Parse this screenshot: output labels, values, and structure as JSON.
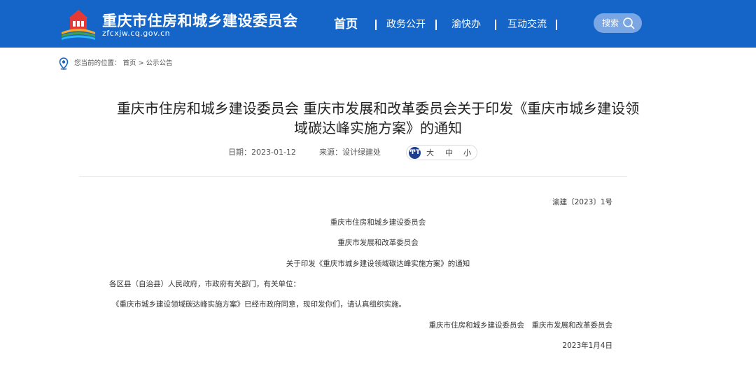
{
  "header": {
    "title": "重庆市住房和城乡建设委员会",
    "domain": "zfcxjw.cq.gov.cn",
    "nav": [
      "首页",
      "政务公开",
      "渝快办",
      "互动交流"
    ],
    "search_label": "搜索"
  },
  "breadcrumb": {
    "prefix": "您当前的位置：",
    "path": "首页 > 公示公告"
  },
  "article": {
    "title_line1": "重庆市住房和城乡建设委员会 重庆市发展和改革委员会关于印发《重庆市城乡建设领",
    "title_line2": "域碳达峰实施方案》的通知",
    "date": "日期：2023-01-12",
    "source": "来源：设计绿建处",
    "font_size_options": [
      "大",
      "中",
      "小"
    ],
    "font_icon_label": "ͲT",
    "doc_number": "渝建〔2023〕1号",
    "issuer1": "重庆市住房和城乡建设委员会",
    "issuer2": "重庆市发展和改革委员会",
    "subject": "关于印发《重庆市城乡建设领域碳达峰实施方案》的通知",
    "salutation": "各区县（自治县）人民政府，市政府有关部门，有关单位：",
    "body": "《重庆市城乡建设领域碳达峰实施方案》已经市政府同意，现印发你们，请认真组织实施。",
    "signature": "重庆市住房和城乡建设委员会　重庆市发展和改革委员会",
    "sign_date": "2023年1月4日"
  },
  "colors": {
    "header_bg": "#1565c8",
    "search_bg": "#7aa7e3"
  }
}
